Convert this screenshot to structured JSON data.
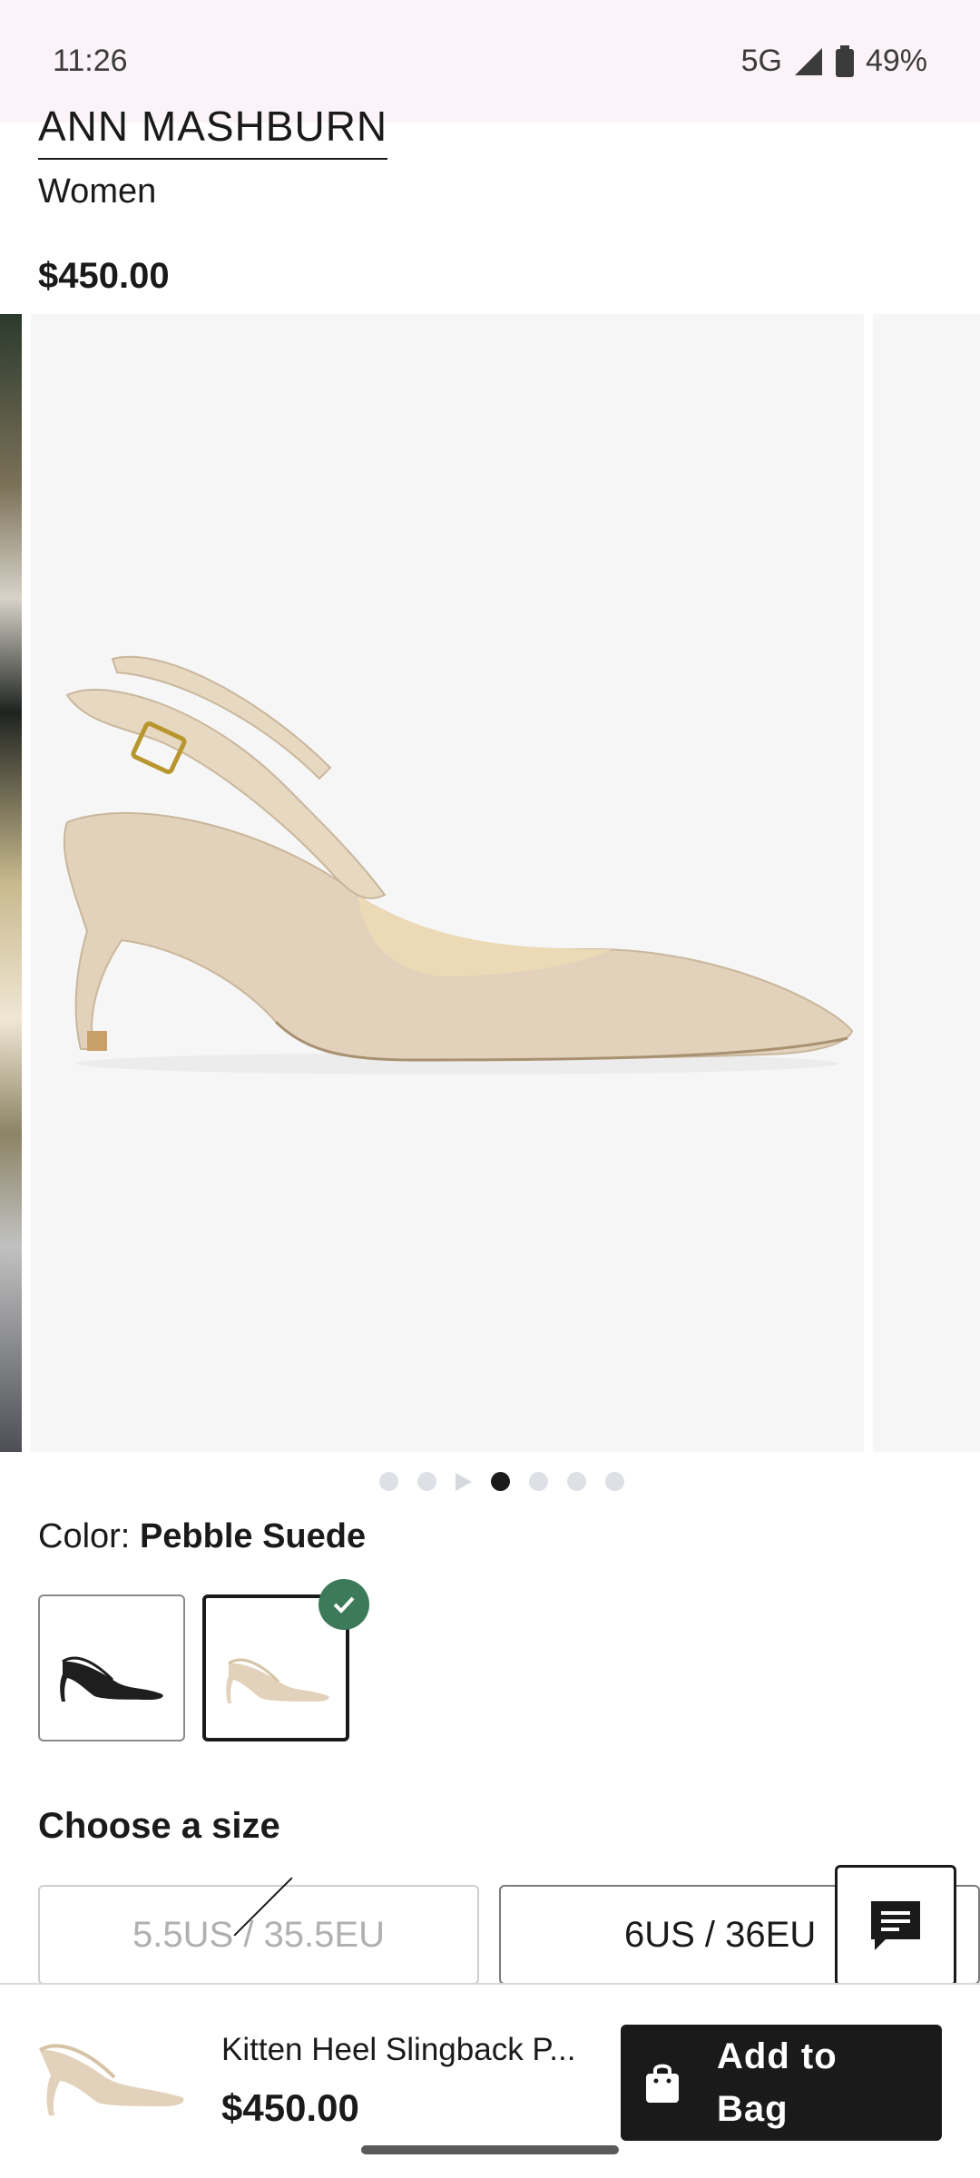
{
  "status": {
    "time": "11:26",
    "network": "5G",
    "battery": "49%"
  },
  "product": {
    "brand": "ANN MASHBURN",
    "category": "Women",
    "price": "$450.00",
    "name": "Kitten Heel Slingback P..."
  },
  "gallery": {
    "dot_count": 7,
    "active_index": 3
  },
  "color": {
    "label": "Color:",
    "value": "Pebble Suede",
    "swatches": [
      "Black Suede",
      "Pebble Suede"
    ],
    "selected_index": 1
  },
  "size": {
    "title": "Choose a size",
    "options": [
      {
        "label": "5.5US / 35.5EU",
        "available": false
      },
      {
        "label": "6US / 36EU",
        "available": true
      }
    ]
  },
  "bottom_bar": {
    "add_label_line1": "Add to",
    "add_label_line2": "Bag",
    "price": "$450.00"
  },
  "colors": {
    "accent_check": "#3d7a5a",
    "button": "#1a1a1a",
    "shoe": "#e2d2bb"
  }
}
